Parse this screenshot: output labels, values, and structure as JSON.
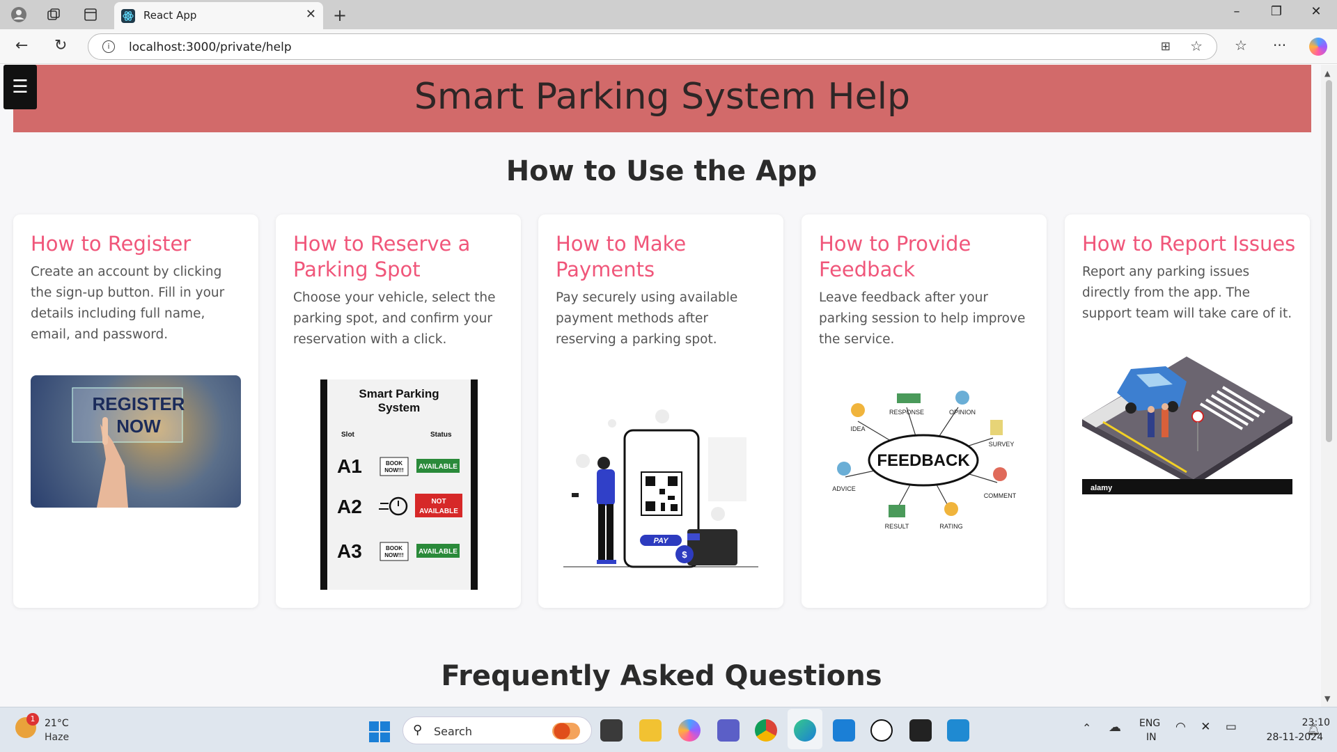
{
  "browser": {
    "tab_title": "React App",
    "url": "localhost:3000/private/help",
    "new_tab_icon": "plus-icon"
  },
  "page": {
    "menu_icon": "☰",
    "header_title": "Smart Parking System Help",
    "section_title": "How to Use the App",
    "faq_title": "Frequently Asked Questions",
    "cards": [
      {
        "title": "How to Register",
        "text": "Create an account by clicking the sign-up button. Fill in your details including full name, email, and password.",
        "image": "register-now-image",
        "image_text": [
          "REGISTER",
          "NOW"
        ]
      },
      {
        "title": "How to Reserve a Parking Spot",
        "text": "Choose your vehicle, select the parking spot, and confirm your reservation with a click.",
        "image": "smart-parking-slots-image",
        "image_text": {
          "title": "Smart Parking System",
          "col_slot": "Slot",
          "col_status": "Status",
          "rows": [
            {
              "slot": "A1",
              "book": "BOOK NOW!!!",
              "status": "AVAILABLE"
            },
            {
              "slot": "A2",
              "book": "",
              "status": "NOT AVAILABLE"
            },
            {
              "slot": "A3",
              "book": "BOOK NOW!!!",
              "status": "AVAILABLE"
            }
          ]
        }
      },
      {
        "title": "How to Make Payments",
        "text": "Pay securely using available payment methods after reserving a parking spot.",
        "image": "qr-payment-image",
        "image_text": {
          "pay": "PAY",
          "dollar": "$"
        }
      },
      {
        "title": "How to Provide Feedback",
        "text": "Leave feedback after your parking session to help improve the service.",
        "image": "feedback-mindmap-image",
        "image_text": {
          "center": "FEEDBACK",
          "labels": [
            "IDEA",
            "RESPONSE",
            "OPINION",
            "SURVEY",
            "ADVICE",
            "COMMENT",
            "RESULT",
            "RATING"
          ]
        }
      },
      {
        "title": "How to Report Issues",
        "text": "Report any parking issues directly from the app. The support team will take care of it.",
        "image": "parking-incident-image",
        "image_text": {
          "watermark": "alamy"
        }
      }
    ]
  },
  "taskbar": {
    "weather_temp": "21°C",
    "weather_desc": "Haze",
    "weather_badge": "1",
    "search_label": "Search",
    "lang_line1": "ENG",
    "lang_line2": "IN",
    "time": "23:10",
    "date": "28-11-2024"
  },
  "colors": {
    "header_bg": "#d26a6a",
    "card_title": "#f0567a",
    "page_bg": "#f7f7f9"
  }
}
